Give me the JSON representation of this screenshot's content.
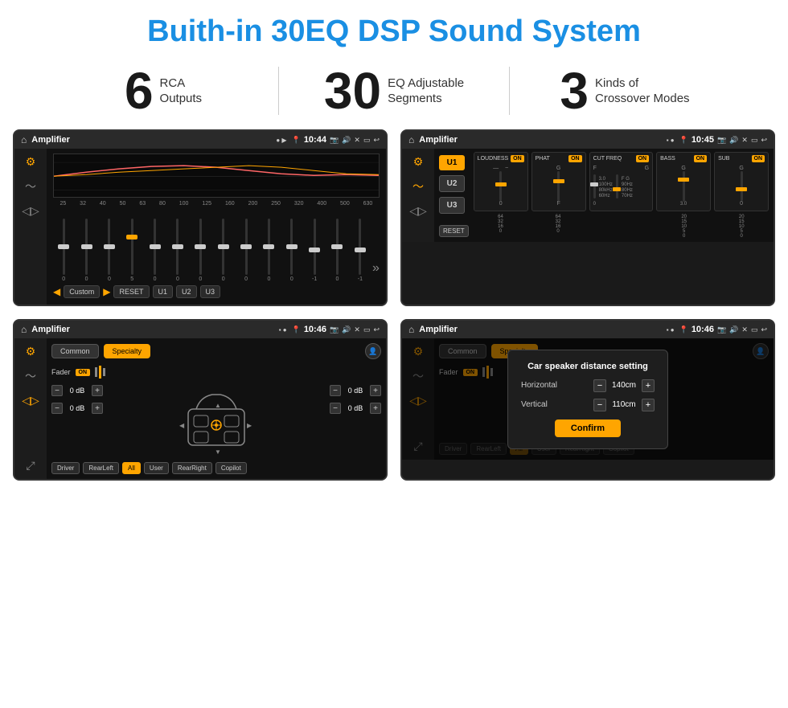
{
  "page": {
    "title": "Buith-in 30EQ DSP Sound System"
  },
  "stats": [
    {
      "number": "6",
      "label_line1": "RCA",
      "label_line2": "Outputs"
    },
    {
      "number": "30",
      "label_line1": "EQ Adjustable",
      "label_line2": "Segments"
    },
    {
      "number": "3",
      "label_line1": "Kinds of",
      "label_line2": "Crossover Modes"
    }
  ],
  "screens": {
    "eq": {
      "status_bar": {
        "title": "Amplifier",
        "time": "10:44"
      },
      "freq_labels": [
        "25",
        "32",
        "40",
        "50",
        "63",
        "80",
        "100",
        "125",
        "160",
        "200",
        "250",
        "320",
        "400",
        "500",
        "630"
      ],
      "slider_values": [
        "0",
        "0",
        "0",
        "5",
        "0",
        "0",
        "0",
        "0",
        "0",
        "0",
        "0",
        "-1",
        "0",
        "-1"
      ],
      "bottom_btns": [
        "Custom",
        "RESET",
        "U1",
        "U2",
        "U3"
      ]
    },
    "crossover": {
      "status_bar": {
        "title": "Amplifier",
        "time": "10:45"
      },
      "presets": [
        "U1",
        "U2",
        "U3"
      ],
      "channels": [
        {
          "name": "LOUDNESS",
          "on": true
        },
        {
          "name": "PHAT",
          "on": true
        },
        {
          "name": "CUT FREQ",
          "on": true
        },
        {
          "name": "BASS",
          "on": true
        },
        {
          "name": "SUB",
          "on": true
        }
      ]
    },
    "speaker": {
      "status_bar": {
        "title": "Amplifier",
        "time": "10:46"
      },
      "tabs": [
        "Common",
        "Specialty"
      ],
      "active_tab": "Specialty",
      "fader_label": "Fader",
      "fader_on": "ON",
      "db_controls": [
        "0 dB",
        "0 dB",
        "0 dB",
        "0 dB"
      ],
      "speaker_btns": [
        "Driver",
        "RearLeft",
        "All",
        "User",
        "RearRight",
        "Copilot"
      ]
    },
    "speaker_dialog": {
      "status_bar": {
        "title": "Amplifier",
        "time": "10:46"
      },
      "tabs": [
        "Common",
        "Specialty"
      ],
      "fader_label": "Fader",
      "fader_on": "ON",
      "dialog": {
        "title": "Car speaker distance setting",
        "horizontal_label": "Horizontal",
        "horizontal_value": "140cm",
        "vertical_label": "Vertical",
        "vertical_value": "110cm",
        "confirm_label": "Confirm"
      },
      "bottom_btns": [
        "Driver",
        "RearLeft",
        "All",
        "User",
        "RearRight",
        "Copilot"
      ]
    }
  }
}
